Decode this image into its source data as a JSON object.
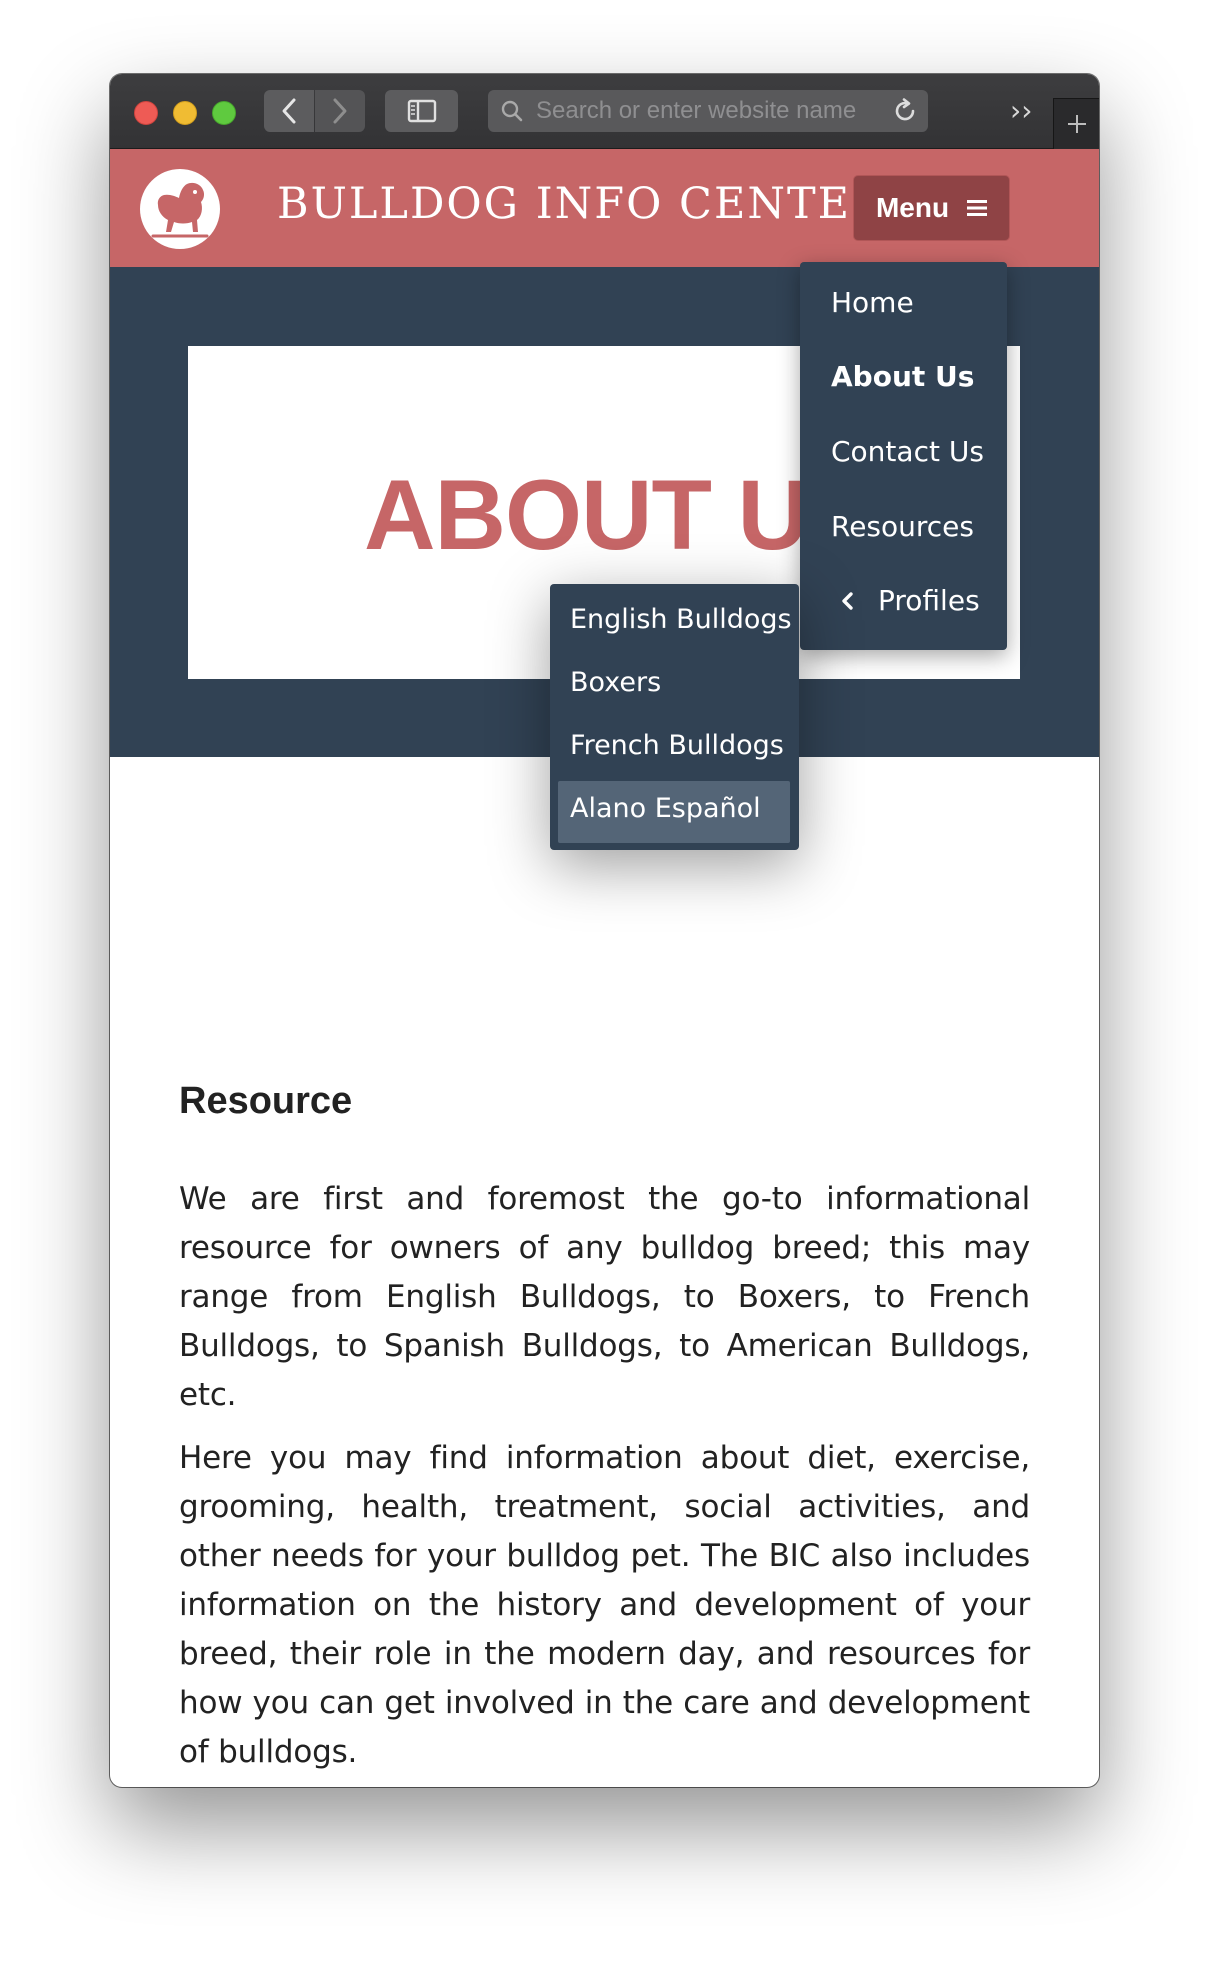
{
  "browser": {
    "address_placeholder": "Search or enter website name",
    "more_label": "››"
  },
  "header": {
    "site_title": "BULLDOG INFO CENTER",
    "menu_label": "Menu"
  },
  "hero": {
    "title": "ABOUT US"
  },
  "menu": {
    "items": [
      {
        "label": "Home"
      },
      {
        "label": "About Us"
      },
      {
        "label": "Contact Us"
      },
      {
        "label": "Resources"
      },
      {
        "label": "Profiles"
      }
    ]
  },
  "profiles_submenu": {
    "items": [
      {
        "label": "English Bulldogs"
      },
      {
        "label": "Boxers"
      },
      {
        "label": "French Bulldogs"
      },
      {
        "label": "Alano Español"
      }
    ]
  },
  "content": {
    "heading": "Resource",
    "paragraphs": [
      "We are first and foremost the go-to informational resource for owners of any bulldog breed; this may range from English Bulldogs, to Boxers, to French Bulldogs, to Spanish Bulldogs, to American Bulldogs, etc.",
      "Here you may find information about diet, exercise, grooming, health, treatment, social activities, and other needs for your bulldog pet. The BIC also includes information on the history and development of your breed, their role in the modern day, and resources for how you can get involved in the care and development of bulldogs."
    ]
  },
  "colors": {
    "brand_red": "#c66667",
    "navy": "#314254",
    "menu_button": "#8f4345",
    "submenu_highlight": "#546577"
  }
}
